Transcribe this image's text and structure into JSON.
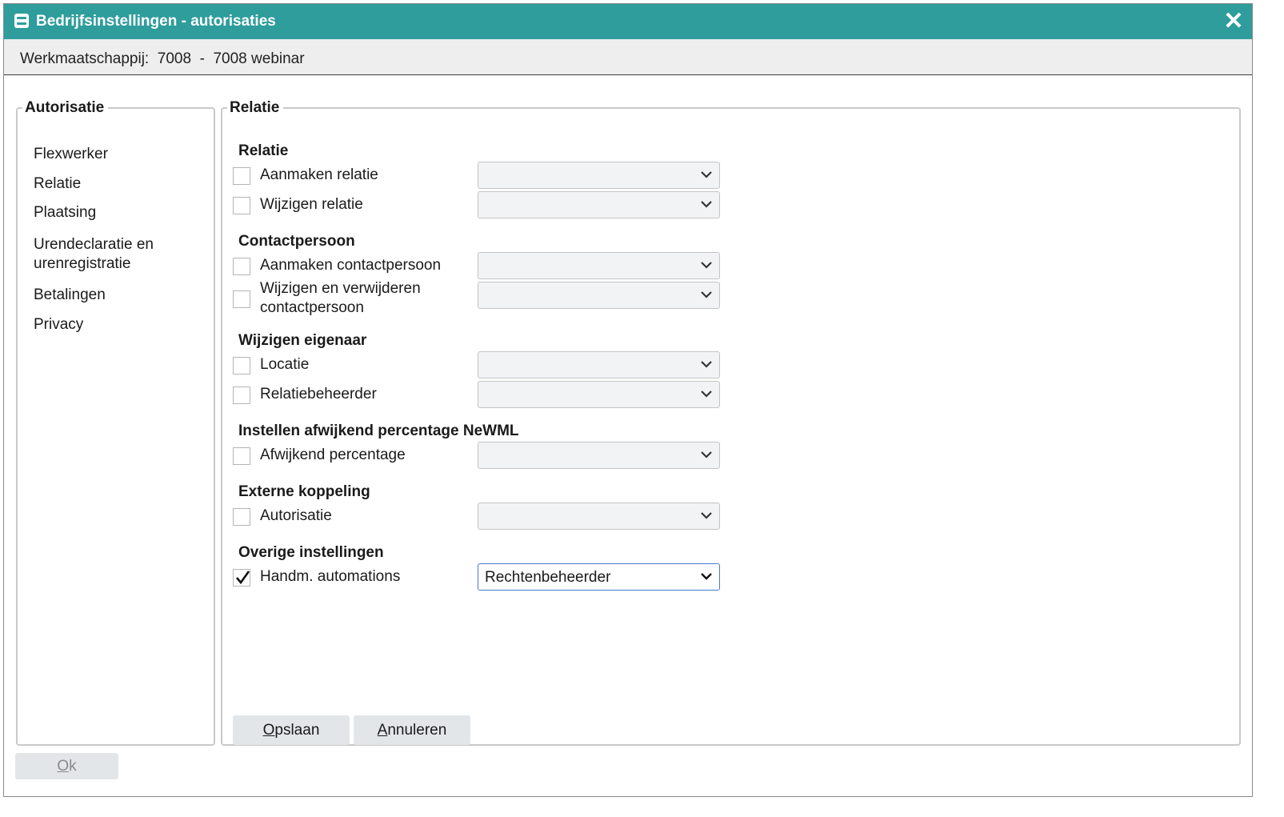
{
  "window": {
    "title": "Bedrijfsinstellingen - autorisaties",
    "company": "Werkmaatschappij:  7008  -  7008 webinar"
  },
  "sidebar": {
    "legend": "Autorisatie",
    "items": [
      {
        "label": "Flexwerker"
      },
      {
        "label": "Relatie"
      },
      {
        "label": "Plaatsing"
      },
      {
        "label": "Urendeclaratie en urenregistratie"
      },
      {
        "label": "Betalingen"
      },
      {
        "label": "Privacy"
      }
    ]
  },
  "main": {
    "legend": "Relatie",
    "sections": [
      {
        "title": "Relatie",
        "rows": [
          {
            "label": "Aanmaken relatie",
            "checked": false,
            "value": ""
          },
          {
            "label": "Wijzigen relatie",
            "checked": false,
            "value": ""
          }
        ]
      },
      {
        "title": "Contactpersoon",
        "rows": [
          {
            "label": "Aanmaken contactpersoon",
            "checked": false,
            "value": ""
          },
          {
            "label": "Wijzigen en verwijderen contactpersoon",
            "checked": false,
            "value": ""
          }
        ]
      },
      {
        "title": "Wijzigen eigenaar",
        "rows": [
          {
            "label": "Locatie",
            "checked": false,
            "value": ""
          },
          {
            "label": "Relatiebeheerder",
            "checked": false,
            "value": ""
          }
        ]
      },
      {
        "title": "Instellen afwijkend percentage NeWML",
        "rows": [
          {
            "label": "Afwijkend percentage",
            "checked": false,
            "value": ""
          }
        ]
      },
      {
        "title": "Externe koppeling",
        "rows": [
          {
            "label": "Autorisatie",
            "checked": false,
            "value": ""
          }
        ]
      },
      {
        "title": "Overige instellingen",
        "rows": [
          {
            "label": "Handm. automations",
            "checked": true,
            "value": "Rechtenbeheerder"
          }
        ]
      }
    ],
    "buttons": {
      "save": {
        "accel": "O",
        "rest": "pslaan"
      },
      "cancel": {
        "accel": "A",
        "rest": "nnuleren"
      }
    }
  },
  "footer": {
    "ok": {
      "accel": "O",
      "rest": "k"
    }
  }
}
